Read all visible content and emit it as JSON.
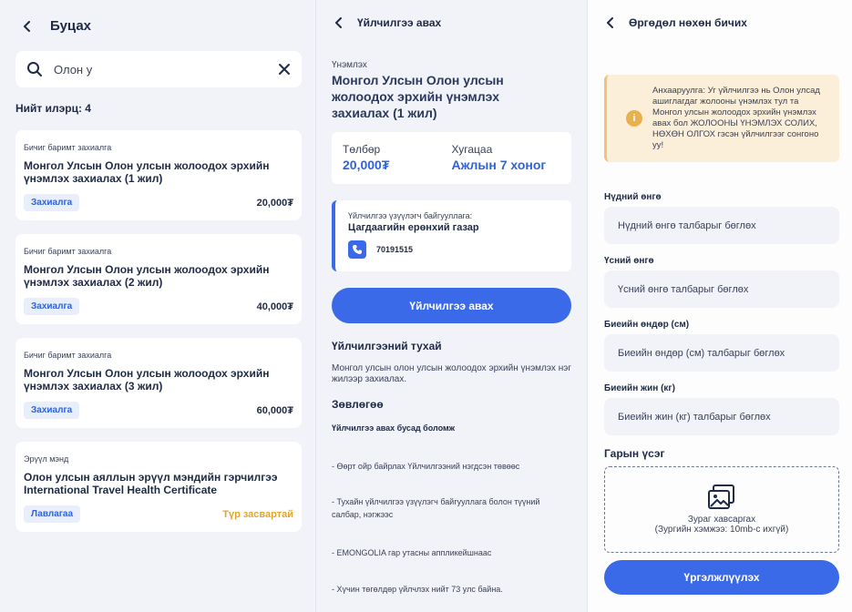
{
  "list_screen": {
    "title": "Буцах",
    "search": {
      "value": "Олон у"
    },
    "result_count": "Нийт илэрц: 4",
    "items": [
      {
        "category": "Бичиг баримт захиалга",
        "name": "Монгол Улсын Олон улсын жолоодох эрхийн үнэмлэх захиалах (1 жил)",
        "badge": "Захиалга",
        "price": "20,000₮"
      },
      {
        "category": "Бичиг баримт захиалга",
        "name": "Монгол Улсын Олон улсын жолоодох эрхийн үнэмлэх захиалах (2 жил)",
        "badge": "Захиалга",
        "price": "40,000₮"
      },
      {
        "category": "Бичиг баримт захиалга",
        "name": "Монгол Улсын Олон улсын жолоодох эрхийн үнэмлэх захиалах (3 жил)",
        "badge": "Захиалга",
        "price": "60,000₮"
      },
      {
        "category": "Эрүүл мэнд",
        "name": "Олон улсын аяллын эрүүл мэндийн гэрчилгээ International Travel Health Certificate",
        "badge": "Лавлагаа",
        "price": "Түр засвартай"
      }
    ]
  },
  "detail_screen": {
    "title": "Үйлчилгээ авах",
    "sub_label": "Үнэмлэх",
    "service_title": "Монгол Улсын Олон улсын жолоодох эрхийн үнэмлэх захиалах (1 жил)",
    "fee_label": "Төлбөр",
    "fee_value": "20,000₮",
    "duration_label": "Хугацаа",
    "duration_value": "Ажлын 7 хоног",
    "org_label": "Үйлчилгээ үзүүлэгч байгууллага:",
    "org_name": "Цагдаагийн ерөнхий газар",
    "phone": "70191515",
    "button": "Үйлчилгээ авах",
    "about_heading": "Үйлчилгээний тухай",
    "about_text": "Монгол улсын олон улсын жолоодох эрхийн үнэмлэх нэг жилээр захиалах.",
    "tips_heading": "Зөвлөгөө",
    "tips_sub": "Үйлчилгээ авах бусад боломж",
    "tips": [
      "- Өөрт ойр байрлах Үйлчилгээний нэгдсэн төвөөс",
      "- Тухайн үйлчилгээ үзүүлэгч байгууллага болон түүний салбар, нэгжээс",
      "- EMONGOLIA гар утасны аппликейшнаас",
      "- Хүчин төгөлдөр үйлчлэх нийт 73 улс байна."
    ]
  },
  "form_screen": {
    "title": "Өргөдөл нөхөн бичих",
    "warning": "Анхааруулга: Уг үйлчилгээ нь Олон улсад ашиглагдаг жолооны үнэмлэх тул та Монгол улсын жолоодох эрхийн үнэмлэх авах бол ЖОЛООНЫ ҮНЭМЛЭХ СОЛИХ, НӨХӨН ОЛГОХ гэсэн үйлчилгээг сонгоно уу!",
    "fields": [
      {
        "label": "Нүдний өнгө",
        "placeholder": "Нүдний өнгө талбарыг бөглөх"
      },
      {
        "label": "Үсний өнгө",
        "placeholder": "Үсний өнгө талбарыг бөглөх"
      },
      {
        "label": "Биеийн өндөр (см)",
        "placeholder": "Биеийн өндөр (см) талбарыг бөглөх"
      },
      {
        "label": "Биеийн жин (кг)",
        "placeholder": "Биеийн жин (кг) талбарыг бөглөх"
      }
    ],
    "signature_label": "Гарын үсэг",
    "upload_text": "Зураг хавсаргах",
    "upload_hint": "(Зургийн хэмжээ: 10mb-с ихгүй)",
    "button": "Үргэлжлүүлэх"
  },
  "colors": {
    "primary": "#3a6ae8",
    "warning_bg": "#fcefd9",
    "warning_icon": "#e8b04f",
    "badge_bg": "#e8eefb",
    "status_warn": "#e3a52b"
  }
}
